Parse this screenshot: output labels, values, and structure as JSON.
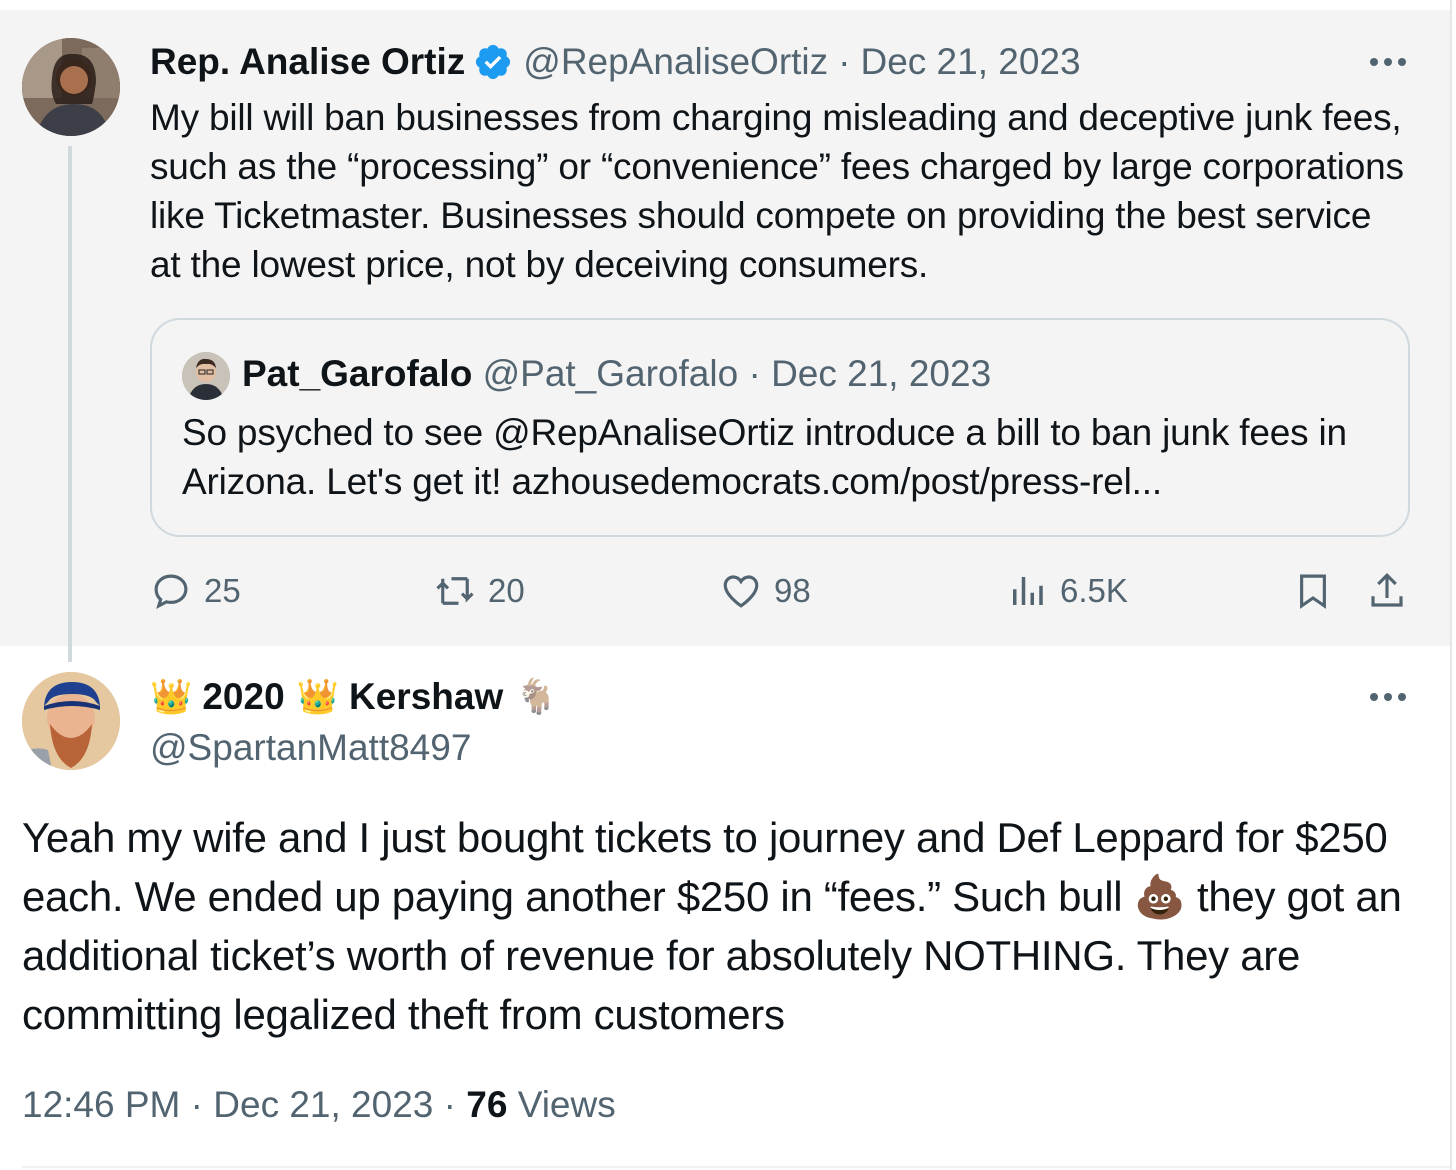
{
  "parent_tweet": {
    "author_name": "Rep. Analise Ortiz",
    "author_handle": "@RepAnaliseOrtiz",
    "separator": "·",
    "date": "Dec 21, 2023",
    "text": "My bill will ban businesses from charging misleading and deceptive junk fees, such as the “processing” or “convenience” fees charged by large corporations like Ticketmaster. Businesses should compete on providing the best service at the lowest price, not by deceiving consumers.",
    "quote": {
      "author_name": "Pat_Garofalo",
      "author_handle": "@Pat_Garofalo",
      "separator": "·",
      "date": "Dec 21, 2023",
      "text": "So psyched to see @RepAnaliseOrtiz introduce a bill to ban junk fees in Arizona. Let's get it! azhousedemocrats.com/post/press-rel..."
    },
    "actions": {
      "replies": "25",
      "retweets": "20",
      "likes": "98",
      "views": "6.5K"
    }
  },
  "reply_tweet": {
    "name_prefix_emoji": "👑",
    "name_part1": "2020",
    "name_mid_emoji": "👑",
    "name_part2": "Kershaw",
    "name_suffix_emoji": "🐐",
    "author_handle": "@SpartanMatt8497",
    "text": "Yeah my wife and I just bought tickets to journey and Def Leppard for $250 each. We ended up paying another $250 in “fees.” Such bull 💩 they got an additional ticket’s worth of revenue for absolutely NOTHING. They are committing legalized theft from customers",
    "time": "12:46 PM",
    "separator": "·",
    "date": "Dec 21, 2023",
    "views_count": "76",
    "views_label": "Views"
  },
  "colors": {
    "text_primary": "#0f1419",
    "text_secondary": "#536471",
    "verified_blue": "#1d9bf0",
    "parent_background": "#f4f4f4",
    "border": "#cfd9de"
  },
  "icons": [
    "verified-badge-icon",
    "more-icon",
    "reply-icon",
    "retweet-icon",
    "like-icon",
    "views-icon",
    "bookmark-icon",
    "share-icon"
  ]
}
